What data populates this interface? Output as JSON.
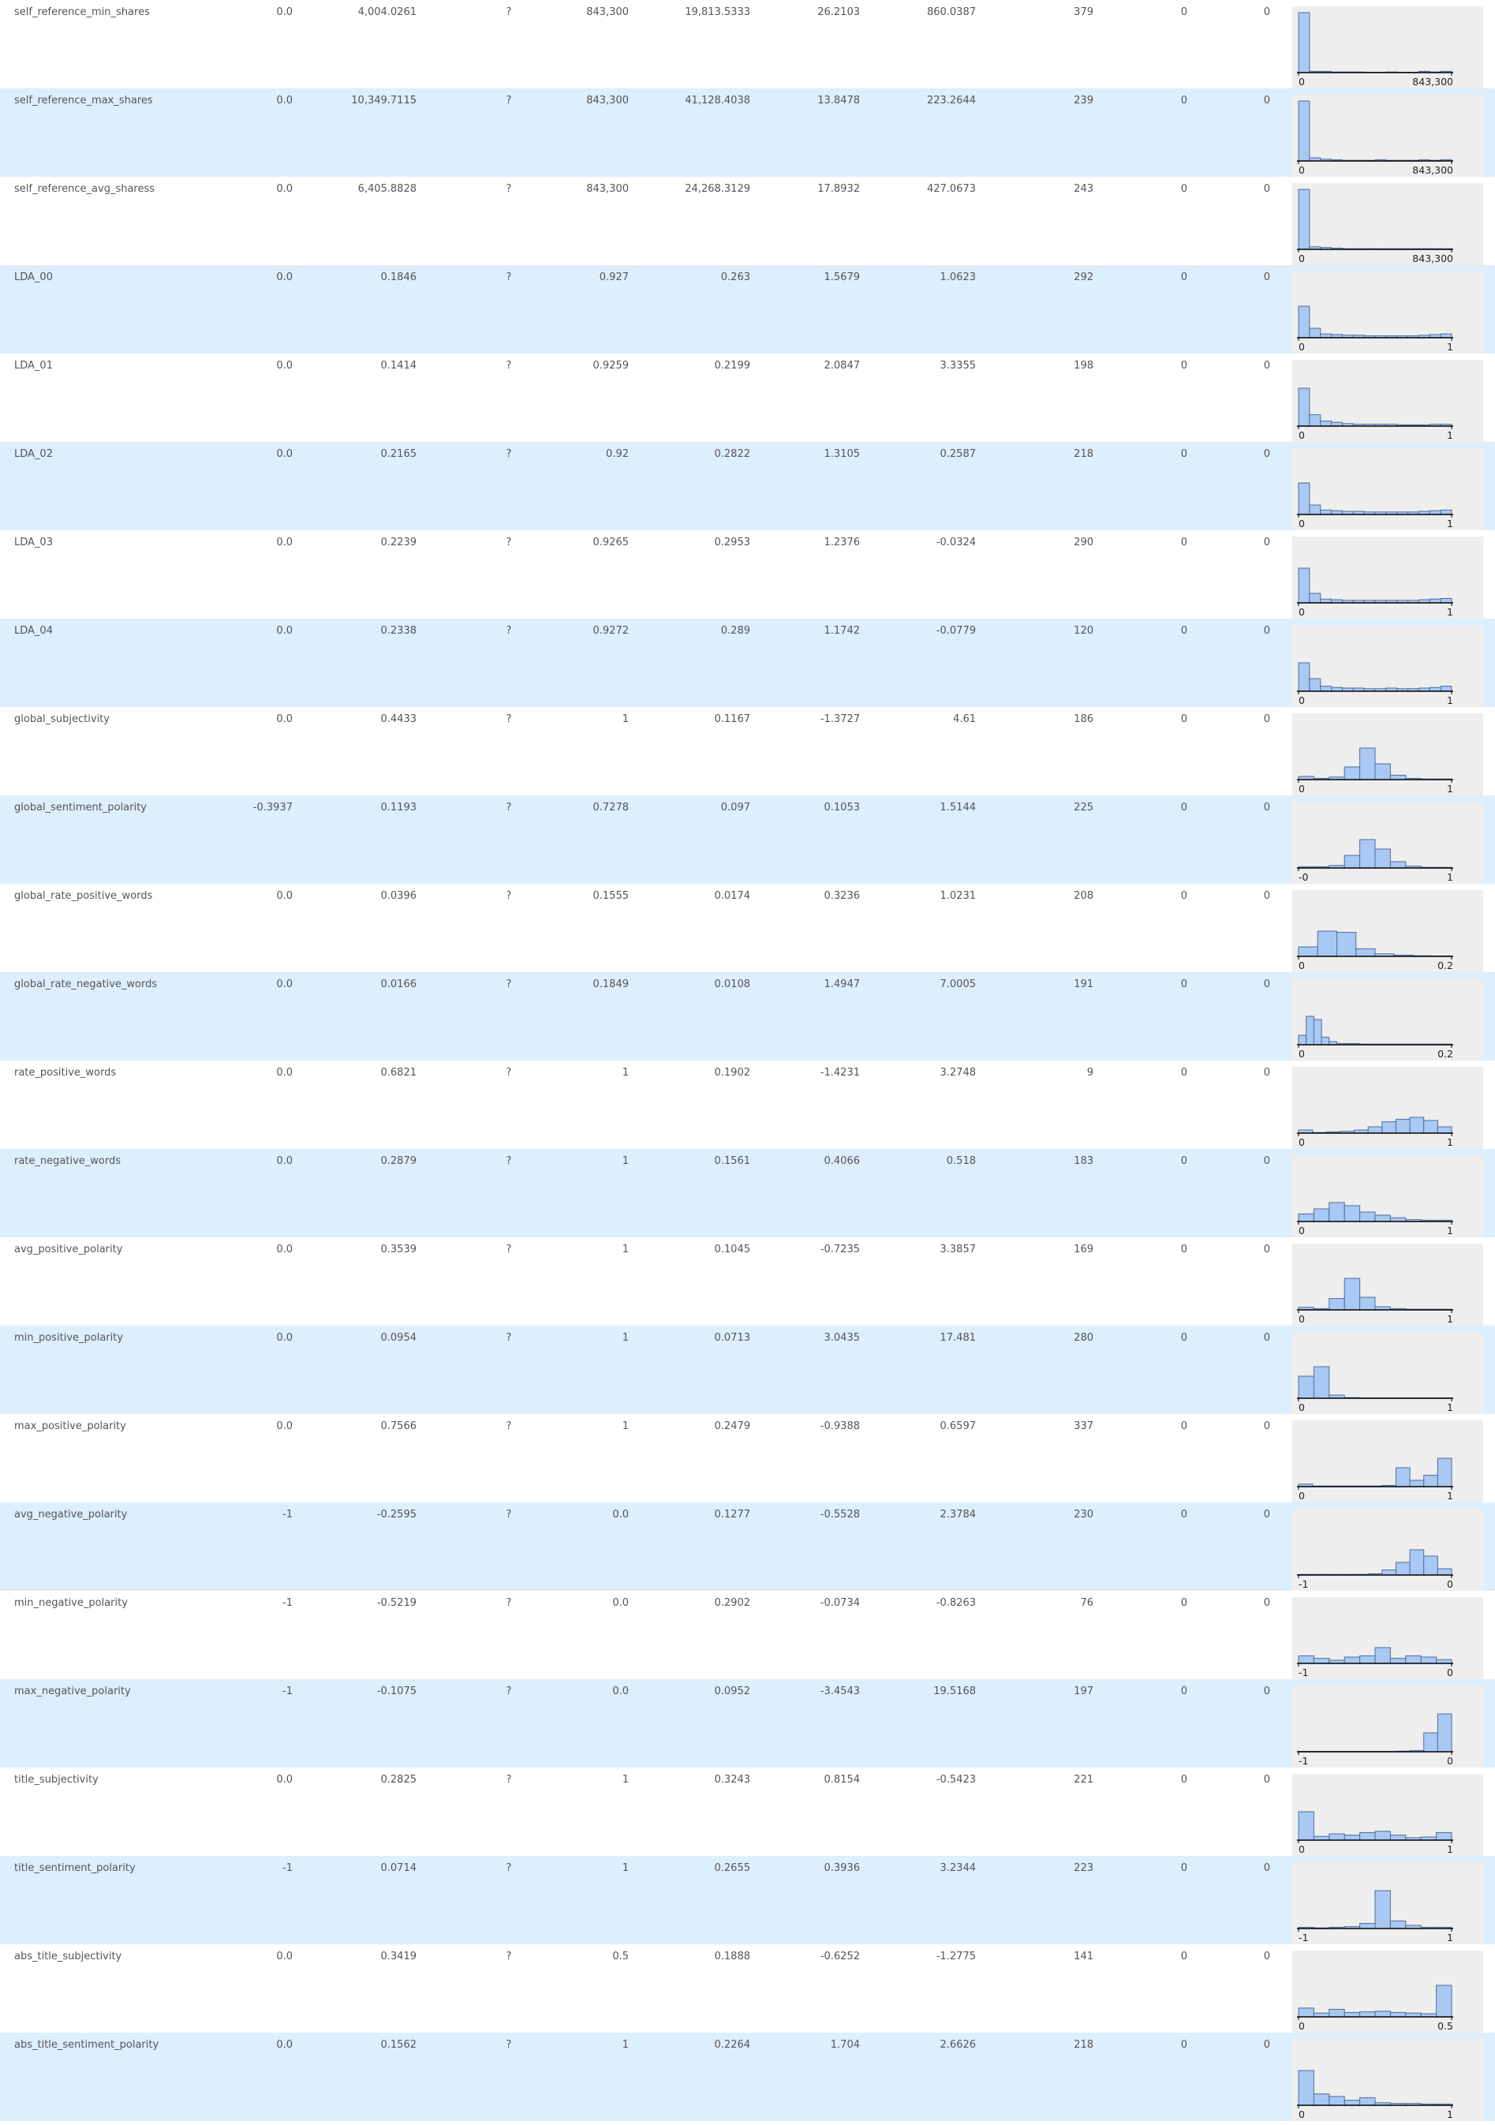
{
  "colors": {
    "row_alt": "#ddeefd",
    "hist_bg": "#eeeeee",
    "bar_fill": "#a9c8f3",
    "bar_stroke": "#4f6d99"
  },
  "rows": [
    {
      "name": "self_reference_min_shares",
      "min": "0.0",
      "mean": "4,004.0261",
      "median": "?",
      "max": "843,300",
      "std": "19,813.5333",
      "skew": "26.2103",
      "kurt": "860.0387",
      "unique": "379",
      "missing": "0",
      "zeros": "0",
      "hist": {
        "lo": "0",
        "hi": "843,300",
        "bins": [
          0.95,
          0.02,
          0.02,
          0.01,
          0.01,
          0.01,
          0.005,
          0.005,
          0.01,
          0.005,
          0.005,
          0.02,
          0.01,
          0.02
        ]
      }
    },
    {
      "name": "self_reference_max_shares",
      "min": "0.0",
      "mean": "10,349.7115",
      "median": "?",
      "max": "843,300",
      "std": "41,128.4038",
      "skew": "13.8478",
      "kurt": "223.2644",
      "unique": "239",
      "missing": "0",
      "zeros": "0",
      "hist": {
        "lo": "0",
        "hi": "843,300",
        "bins": [
          0.95,
          0.05,
          0.03,
          0.02,
          0.01,
          0.01,
          0.01,
          0.02,
          0.01,
          0.01,
          0.01,
          0.02,
          0.01,
          0.02
        ]
      }
    },
    {
      "name": "self_reference_avg_sharess",
      "min": "0.0",
      "mean": "6,405.8828",
      "median": "?",
      "max": "843,300",
      "std": "24,268.3129",
      "skew": "17.8932",
      "kurt": "427.0673",
      "unique": "243",
      "missing": "0",
      "zeros": "0",
      "hist": {
        "lo": "0",
        "hi": "843,300",
        "bins": [
          0.95,
          0.04,
          0.03,
          0.02,
          0.01,
          0.01,
          0.01,
          0.01,
          0.01,
          0.01,
          0.01,
          0.01,
          0.01,
          0.01
        ]
      }
    },
    {
      "name": "LDA_00",
      "min": "0.0",
      "mean": "0.1846",
      "median": "?",
      "max": "0.927",
      "std": "0.263",
      "skew": "1.5679",
      "kurt": "1.0623",
      "unique": "292",
      "missing": "0",
      "zeros": "0",
      "hist": {
        "lo": "0",
        "hi": "1",
        "bins": [
          0.5,
          0.15,
          0.06,
          0.05,
          0.04,
          0.04,
          0.03,
          0.03,
          0.03,
          0.03,
          0.03,
          0.04,
          0.05,
          0.06
        ]
      }
    },
    {
      "name": "LDA_01",
      "min": "0.0",
      "mean": "0.1414",
      "median": "?",
      "max": "0.9259",
      "std": "0.2199",
      "skew": "2.0847",
      "kurt": "3.3355",
      "unique": "198",
      "missing": "0",
      "zeros": "0",
      "hist": {
        "lo": "0",
        "hi": "1",
        "bins": [
          0.6,
          0.18,
          0.08,
          0.06,
          0.04,
          0.03,
          0.03,
          0.03,
          0.03,
          0.02,
          0.02,
          0.02,
          0.03,
          0.03
        ]
      }
    },
    {
      "name": "LDA_02",
      "min": "0.0",
      "mean": "0.2165",
      "median": "?",
      "max": "0.92",
      "std": "0.2822",
      "skew": "1.3105",
      "kurt": "0.2587",
      "unique": "218",
      "missing": "0",
      "zeros": "0",
      "hist": {
        "lo": "0",
        "hi": "1",
        "bins": [
          0.5,
          0.15,
          0.07,
          0.06,
          0.05,
          0.05,
          0.04,
          0.04,
          0.04,
          0.04,
          0.04,
          0.05,
          0.06,
          0.07
        ]
      }
    },
    {
      "name": "LDA_03",
      "min": "0.0",
      "mean": "0.2239",
      "median": "?",
      "max": "0.9265",
      "std": "0.2953",
      "skew": "1.2376",
      "kurt": "-0.0324",
      "unique": "290",
      "missing": "0",
      "zeros": "0",
      "hist": {
        "lo": "0",
        "hi": "1",
        "bins": [
          0.55,
          0.15,
          0.06,
          0.05,
          0.04,
          0.04,
          0.04,
          0.04,
          0.04,
          0.04,
          0.04,
          0.05,
          0.06,
          0.07
        ]
      }
    },
    {
      "name": "LDA_04",
      "min": "0.0",
      "mean": "0.2338",
      "median": "?",
      "max": "0.9272",
      "std": "0.289",
      "skew": "1.1742",
      "kurt": "-0.0779",
      "unique": "120",
      "missing": "0",
      "zeros": "0",
      "hist": {
        "lo": "0",
        "hi": "1",
        "bins": [
          0.45,
          0.2,
          0.08,
          0.06,
          0.05,
          0.05,
          0.04,
          0.04,
          0.05,
          0.04,
          0.04,
          0.05,
          0.06,
          0.08
        ]
      }
    },
    {
      "name": "global_subjectivity",
      "min": "0.0",
      "mean": "0.4433",
      "median": "?",
      "max": "1",
      "std": "0.1167",
      "skew": "-1.3727",
      "kurt": "4.61",
      "unique": "186",
      "missing": "0",
      "zeros": "0",
      "hist": {
        "lo": "0",
        "hi": "1",
        "bins": [
          0.05,
          0.02,
          0.04,
          0.2,
          0.5,
          0.25,
          0.07,
          0.02,
          0.01,
          0.01
        ]
      }
    },
    {
      "name": "global_sentiment_polarity",
      "min": "-0.3937",
      "mean": "0.1193",
      "median": "?",
      "max": "0.7278",
      "std": "0.097",
      "skew": "0.1053",
      "kurt": "1.5144",
      "unique": "225",
      "missing": "0",
      "zeros": "0",
      "hist": {
        "lo": "-0",
        "hi": "1",
        "bins": [
          0.02,
          0.02,
          0.04,
          0.2,
          0.45,
          0.3,
          0.1,
          0.03,
          0.01,
          0.01
        ]
      }
    },
    {
      "name": "global_rate_positive_words",
      "min": "0.0",
      "mean": "0.0396",
      "median": "?",
      "max": "0.1555",
      "std": "0.0174",
      "skew": "0.3236",
      "kurt": "1.0231",
      "unique": "208",
      "missing": "0",
      "zeros": "0",
      "hist": {
        "lo": "0",
        "hi": "0.2",
        "bins": [
          0.15,
          0.4,
          0.38,
          0.12,
          0.04,
          0.02,
          0.01,
          0.005
        ]
      }
    },
    {
      "name": "global_rate_negative_words",
      "min": "0.0",
      "mean": "0.0166",
      "median": "?",
      "max": "0.1849",
      "std": "0.0108",
      "skew": "1.4947",
      "kurt": "7.0005",
      "unique": "191",
      "missing": "0",
      "zeros": "0",
      "hist": {
        "lo": "0",
        "hi": "0.2",
        "bins": [
          0.15,
          0.45,
          0.4,
          0.12,
          0.05,
          0.02,
          0.02,
          0.02,
          0.01,
          0.01,
          0.01,
          0.01,
          0.01,
          0.01,
          0.01,
          0.01,
          0.01,
          0.01,
          0.01,
          0.01
        ]
      }
    },
    {
      "name": "rate_positive_words",
      "min": "0.0",
      "mean": "0.6821",
      "median": "?",
      "max": "1",
      "std": "0.1902",
      "skew": "-1.4231",
      "kurt": "3.2748",
      "unique": "9",
      "missing": "0",
      "zeros": "0",
      "hist": {
        "lo": "0",
        "hi": "1",
        "bins": [
          0.05,
          0.01,
          0.02,
          0.03,
          0.05,
          0.1,
          0.18,
          0.22,
          0.25,
          0.2,
          0.1
        ]
      }
    },
    {
      "name": "rate_negative_words",
      "min": "0.0",
      "mean": "0.2879",
      "median": "?",
      "max": "1",
      "std": "0.1561",
      "skew": "0.4066",
      "kurt": "0.518",
      "unique": "183",
      "missing": "0",
      "zeros": "0",
      "hist": {
        "lo": "0",
        "hi": "1",
        "bins": [
          0.12,
          0.2,
          0.3,
          0.25,
          0.15,
          0.1,
          0.06,
          0.03,
          0.02,
          0.02
        ]
      }
    },
    {
      "name": "avg_positive_polarity",
      "min": "0.0",
      "mean": "0.3539",
      "median": "?",
      "max": "1",
      "std": "0.1045",
      "skew": "-0.7235",
      "kurt": "3.3857",
      "unique": "169",
      "missing": "0",
      "zeros": "0",
      "hist": {
        "lo": "0",
        "hi": "1",
        "bins": [
          0.04,
          0.02,
          0.18,
          0.5,
          0.2,
          0.05,
          0.02,
          0.01,
          0.01,
          0.01
        ]
      }
    },
    {
      "name": "min_positive_polarity",
      "min": "0.0",
      "mean": "0.0954",
      "median": "?",
      "max": "1",
      "std": "0.0713",
      "skew": "3.0435",
      "kurt": "17.481",
      "unique": "280",
      "missing": "0",
      "zeros": "0",
      "hist": {
        "lo": "0",
        "hi": "1",
        "bins": [
          0.35,
          0.5,
          0.05,
          0.01,
          0.005,
          0.005,
          0.005,
          0.005,
          0.005,
          0.005
        ]
      }
    },
    {
      "name": "max_positive_polarity",
      "min": "0.0",
      "mean": "0.7566",
      "median": "?",
      "max": "1",
      "std": "0.2479",
      "skew": "-0.9388",
      "kurt": "0.6597",
      "unique": "337",
      "missing": "0",
      "zeros": "0",
      "hist": {
        "lo": "0",
        "hi": "1",
        "bins": [
          0.04,
          0.01,
          0.01,
          0.01,
          0.01,
          0.01,
          0.02,
          0.3,
          0.1,
          0.18,
          0.45
        ]
      }
    },
    {
      "name": "avg_negative_polarity",
      "min": "-1",
      "mean": "-0.2595",
      "median": "?",
      "max": "0.0",
      "std": "0.1277",
      "skew": "-0.5528",
      "kurt": "2.3784",
      "unique": "230",
      "missing": "0",
      "zeros": "0",
      "hist": {
        "lo": "-1",
        "hi": "0",
        "bins": [
          0.01,
          0.01,
          0.01,
          0.01,
          0.01,
          0.02,
          0.08,
          0.2,
          0.4,
          0.3,
          0.1
        ]
      }
    },
    {
      "name": "min_negative_polarity",
      "min": "-1",
      "mean": "-0.5219",
      "median": "?",
      "max": "0.0",
      "std": "0.2902",
      "skew": "-0.0734",
      "kurt": "-0.8263",
      "unique": "76",
      "missing": "0",
      "zeros": "0",
      "hist": {
        "lo": "-1",
        "hi": "0",
        "bins": [
          0.12,
          0.08,
          0.05,
          0.1,
          0.12,
          0.25,
          0.08,
          0.12,
          0.1,
          0.06
        ]
      }
    },
    {
      "name": "max_negative_polarity",
      "min": "-1",
      "mean": "-0.1075",
      "median": "?",
      "max": "0.0",
      "std": "0.0952",
      "skew": "-3.4543",
      "kurt": "19.5168",
      "unique": "197",
      "missing": "0",
      "zeros": "0",
      "hist": {
        "lo": "-1",
        "hi": "0",
        "bins": [
          0.005,
          0.005,
          0.005,
          0.005,
          0.005,
          0.005,
          0.005,
          0.01,
          0.02,
          0.3,
          0.6
        ]
      }
    },
    {
      "name": "title_subjectivity",
      "min": "0.0",
      "mean": "0.2825",
      "median": "?",
      "max": "1",
      "std": "0.3243",
      "skew": "0.8154",
      "kurt": "-0.5423",
      "unique": "221",
      "missing": "0",
      "zeros": "0",
      "hist": {
        "lo": "0",
        "hi": "1",
        "bins": [
          0.45,
          0.06,
          0.1,
          0.08,
          0.12,
          0.14,
          0.08,
          0.04,
          0.05,
          0.12
        ]
      }
    },
    {
      "name": "title_sentiment_polarity",
      "min": "-1",
      "mean": "0.0714",
      "median": "?",
      "max": "1",
      "std": "0.2655",
      "skew": "0.3936",
      "kurt": "3.2344",
      "unique": "223",
      "missing": "0",
      "zeros": "0",
      "hist": {
        "lo": "-1",
        "hi": "1",
        "bins": [
          0.02,
          0.01,
          0.02,
          0.03,
          0.08,
          0.6,
          0.12,
          0.05,
          0.02,
          0.02
        ]
      }
    },
    {
      "name": "abs_title_subjectivity",
      "min": "0.0",
      "mean": "0.3419",
      "median": "?",
      "max": "0.5",
      "std": "0.1888",
      "skew": "-0.6252",
      "kurt": "-1.2775",
      "unique": "141",
      "missing": "0",
      "zeros": "0",
      "hist": {
        "lo": "0",
        "hi": "0.5",
        "bins": [
          0.14,
          0.06,
          0.12,
          0.07,
          0.08,
          0.09,
          0.07,
          0.06,
          0.05,
          0.5
        ]
      }
    },
    {
      "name": "abs_title_sentiment_polarity",
      "min": "0.0",
      "mean": "0.1562",
      "median": "?",
      "max": "1",
      "std": "0.2264",
      "skew": "1.704",
      "kurt": "2.6626",
      "unique": "218",
      "missing": "0",
      "zeros": "0",
      "hist": {
        "lo": "0",
        "hi": "1",
        "bins": [
          0.55,
          0.18,
          0.14,
          0.08,
          0.12,
          0.04,
          0.03,
          0.03,
          0.02,
          0.02
        ]
      }
    }
  ]
}
